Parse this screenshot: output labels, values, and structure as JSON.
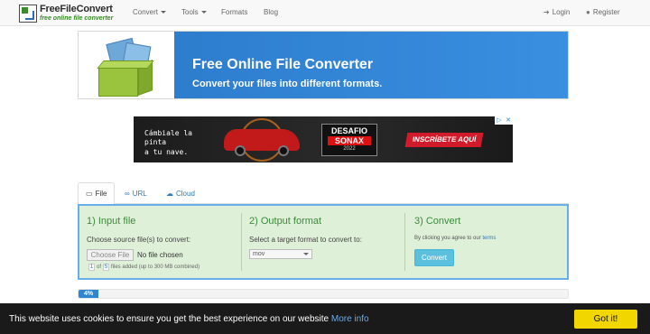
{
  "navbar": {
    "logo_title": "FreeFileConvert",
    "logo_tagline": "free online file converter",
    "menu": [
      {
        "label": "Convert",
        "dropdown": true
      },
      {
        "label": "Tools",
        "dropdown": true
      },
      {
        "label": "Formats",
        "dropdown": false
      },
      {
        "label": "Blog",
        "dropdown": false
      }
    ],
    "login_label": "Login",
    "register_label": "Register"
  },
  "banner": {
    "title": "Free Online File Converter",
    "subtitle": "Convert your files into different formats."
  },
  "ad": {
    "tagline_1": "Cámbiale la pinta",
    "tagline_2": "a tu nave.",
    "logo_1": "DESAFIO",
    "logo_2": "SONAX",
    "logo_3": "2022",
    "cta": "INSCRÍBETE AQUÍ",
    "choices_info": "▷",
    "choices_close": "✕"
  },
  "tabs": [
    {
      "label": "File",
      "icon": "monitor-icon",
      "active": true
    },
    {
      "label": "URL",
      "icon": "link-icon",
      "active": false
    },
    {
      "label": "Cloud",
      "icon": "cloud-icon",
      "active": false
    }
  ],
  "converter": {
    "step1": {
      "title": "1) Input file",
      "instruction": "Choose source file(s) to convert:",
      "choose_button": "Choose File",
      "no_file": "No file chosen",
      "files_count": "1",
      "of_label": "of",
      "files_max": "5",
      "files_note": "files added (up to 300 MB combined)"
    },
    "step2": {
      "title": "2) Output format",
      "instruction": "Select a target format to convert to:",
      "selected_format": "mov"
    },
    "step3": {
      "title": "3) Convert",
      "agree_text": "By clicking you agree to our",
      "terms_link": "terms",
      "convert_button": "Convert"
    }
  },
  "progress": {
    "label": "4%",
    "value": 0.04
  },
  "cookie": {
    "message": "This website uses cookies to ensure you get the best experience on our website",
    "more_info": "More info",
    "accept_button": "Got it!"
  },
  "colors": {
    "panel_bg": "#dff0d8",
    "panel_border": "#66afe9",
    "banner_blue": "#2a79c9",
    "convert_button": "#5bc0de",
    "cookie_button": "#f1d600",
    "progress": "#2e86d3"
  }
}
